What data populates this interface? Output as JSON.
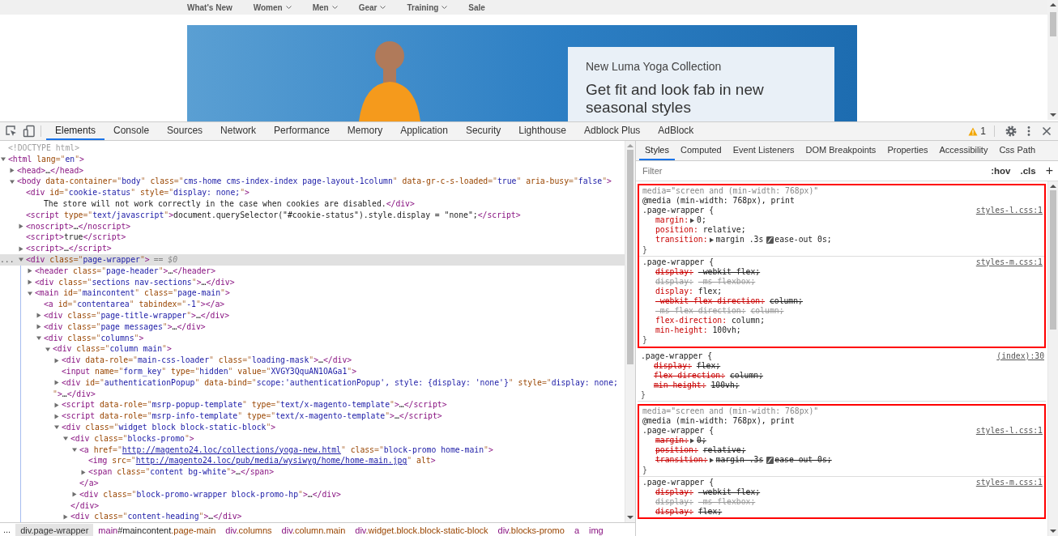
{
  "site": {
    "nav": [
      {
        "label": "What's New",
        "dropdown": false
      },
      {
        "label": "Women",
        "dropdown": true
      },
      {
        "label": "Men",
        "dropdown": true
      },
      {
        "label": "Gear",
        "dropdown": true
      },
      {
        "label": "Training",
        "dropdown": true
      },
      {
        "label": "Sale",
        "dropdown": false
      }
    ],
    "promo": {
      "eyebrow": "New Luma Yoga Collection",
      "headline": "Get fit and look fab in new seasonal styles"
    }
  },
  "devtools": {
    "tabs": [
      {
        "label": "Elements",
        "selected": true
      },
      {
        "label": "Console",
        "selected": false
      },
      {
        "label": "Sources",
        "selected": false
      },
      {
        "label": "Network",
        "selected": false
      },
      {
        "label": "Performance",
        "selected": false
      },
      {
        "label": "Memory",
        "selected": false
      },
      {
        "label": "Application",
        "selected": false
      },
      {
        "label": "Security",
        "selected": false
      },
      {
        "label": "Lighthouse",
        "selected": false
      },
      {
        "label": "Adblock Plus",
        "selected": false
      },
      {
        "label": "AdBlock",
        "selected": false
      }
    ],
    "warnings": "1",
    "dom_tree": [
      {
        "kind": "doctype",
        "text": "<!DOCTYPE html>",
        "selected": false
      },
      {
        "kind": "element",
        "text": "<html lang=\"en\">",
        "expanded": true,
        "selected": false,
        "children": [
          {
            "kind": "element",
            "text": "<head>…</head>",
            "expanded": false,
            "selected": false
          },
          {
            "kind": "element",
            "text": "<body data-container=\"body\" class=\"cms-home cms-index-index page-layout-1column\" data-gr-c-s-loaded=\"true\" aria-busy=\"false\">",
            "expanded": true,
            "selected": false,
            "children": [
              {
                "kind": "element",
                "text": "<div id=\"cookie-status\" style=\"display: none;\">",
                "selected": false,
                "children": [
                  {
                    "kind": "text",
                    "text": "The store will not work correctly in the case when cookies are disabled.</div>",
                    "selected": false
                  }
                ]
              },
              {
                "kind": "element",
                "text": "<script type=\"text/javascript\">document.querySelector(\"#cookie-status\").style.display = \"none\";</script>",
                "selected": false
              },
              {
                "kind": "element",
                "text": "<noscript>…</noscript>",
                "expanded": false,
                "selected": false
              },
              {
                "kind": "element",
                "text": "<script>true</script>",
                "selected": false
              },
              {
                "kind": "element",
                "text": "<script>…</script>",
                "expanded": false,
                "selected": false
              },
              {
                "kind": "element",
                "text": "<div class=\"page-wrapper\">",
                "expanded": true,
                "selected": true,
                "gutter": "...",
                "note": "== $0",
                "children": [
                  {
                    "kind": "element",
                    "text": "<header class=\"page-header\">…</header>",
                    "expanded": false,
                    "selected": false
                  },
                  {
                    "kind": "element",
                    "text": "<div class=\"sections nav-sections\">…</div>",
                    "expanded": false,
                    "selected": false
                  },
                  {
                    "kind": "element",
                    "text": "<main id=\"maincontent\" class=\"page-main\">",
                    "expanded": true,
                    "selected": false,
                    "children": [
                      {
                        "kind": "element",
                        "text": "<a id=\"contentarea\" tabindex=\"-1\"></a>",
                        "selected": false
                      },
                      {
                        "kind": "element",
                        "text": "<div class=\"page-title-wrapper\">…</div>",
                        "expanded": false,
                        "selected": false
                      },
                      {
                        "kind": "element",
                        "text": "<div class=\"page messages\">…</div>",
                        "expanded": false,
                        "selected": false
                      },
                      {
                        "kind": "element",
                        "text": "<div class=\"columns\">",
                        "expanded": true,
                        "selected": false,
                        "children": [
                          {
                            "kind": "element",
                            "text": "<div class=\"column main\">",
                            "expanded": true,
                            "selected": false,
                            "children": [
                              {
                                "kind": "element",
                                "text": "<div data-role=\"main-css-loader\" class=\"loading-mask\">…</div>",
                                "expanded": false,
                                "selected": false
                              },
                              {
                                "kind": "element",
                                "text": "<input name=\"form_key\" type=\"hidden\" value=\"XVGY3QquAN1OAGa1\">",
                                "selected": false
                              },
                              {
                                "kind": "element",
                                "text": "<div id=\"authenticationPopup\" data-bind=\"scope:'authenticationPopup', style: {display: 'none'}\" style=\"display: none;",
                                "continuation": "\">…</div>",
                                "expanded": false,
                                "selected": false
                              },
                              {
                                "kind": "element",
                                "text": "<script data-role=\"msrp-popup-template\" type=\"text/x-magento-template\">…</script>",
                                "expanded": false,
                                "selected": false
                              },
                              {
                                "kind": "element",
                                "text": "<script data-role=\"msrp-info-template\" type=\"text/x-magento-template\">…</script>",
                                "expanded": false,
                                "selected": false
                              },
                              {
                                "kind": "element",
                                "text": "<div class=\"widget block block-static-block\">",
                                "expanded": true,
                                "selected": false,
                                "children": [
                                  {
                                    "kind": "element",
                                    "text": "<div class=\"blocks-promo\">",
                                    "expanded": true,
                                    "selected": false,
                                    "closing": "</div>",
                                    "children": [
                                      {
                                        "kind": "element",
                                        "text": "<a href=\"http://magento24.loc/collections/yoga-new.html\" class=\"block-promo home-main\">",
                                        "expanded": true,
                                        "selected": false,
                                        "link": true,
                                        "closing": "</a>",
                                        "children": [
                                          {
                                            "kind": "element",
                                            "text": "<img src=\"http://magento24.loc/pub/media/wysiwyg/home/home-main.jpg\" alt>",
                                            "selected": false,
                                            "link": true
                                          },
                                          {
                                            "kind": "element",
                                            "text": "<span class=\"content bg-white\">…</span>",
                                            "expanded": false,
                                            "selected": false
                                          }
                                        ]
                                      },
                                      {
                                        "kind": "element",
                                        "text": "<div class=\"block-promo-wrapper block-promo-hp\">…</div>",
                                        "expanded": false,
                                        "selected": false
                                      }
                                    ]
                                  },
                                  {
                                    "kind": "element",
                                    "text": "<div class=\"content-heading\">…</div>",
                                    "expanded": false,
                                    "selected": false
                                  }
                                ]
                              }
                            ]
                          }
                        ]
                      }
                    ]
                  }
                ]
              }
            ]
          }
        ]
      }
    ],
    "breadcrumbs_more": "...",
    "breadcrumbs": [
      {
        "label": "div.page-wrapper",
        "selected": true
      },
      {
        "label": "main#maincontent.page-main",
        "selected": false
      },
      {
        "label": "div.columns",
        "selected": false
      },
      {
        "label": "div.column.main",
        "selected": false
      },
      {
        "label": "div.widget.block.block-static-block",
        "selected": false
      },
      {
        "label": "div.blocks-promo",
        "selected": false
      },
      {
        "label": "a",
        "selected": false
      },
      {
        "label": "img",
        "selected": false
      }
    ],
    "sidebar_tabs": [
      {
        "label": "Styles",
        "selected": true
      },
      {
        "label": "Computed",
        "selected": false
      },
      {
        "label": "Event Listeners",
        "selected": false
      },
      {
        "label": "DOM Breakpoints",
        "selected": false
      },
      {
        "label": "Properties",
        "selected": false
      },
      {
        "label": "Accessibility",
        "selected": false
      },
      {
        "label": "Css Path",
        "selected": false
      }
    ],
    "filter": {
      "placeholder": "Filter"
    },
    "hov": ":hov",
    "cls": ".cls",
    "add": "+",
    "rule_groups": [
      {
        "outlined": true,
        "rules": [
          {
            "media_source": "media=\"screen and (min-width: 768px)\"",
            "media": "@media (min-width: 768px), print",
            "selector": ".page-wrapper {",
            "source": "styles-l.css:1",
            "close": "}",
            "declarations": [
              {
                "name": "margin:",
                "value": "0;",
                "overridden": false,
                "invalid": false,
                "expandable": true
              },
              {
                "name": "position:",
                "value": "relative;",
                "overridden": false,
                "invalid": false,
                "expandable": false
              },
              {
                "name": "transition:",
                "value": "margin .3s",
                "easing": "ease-out 0s;",
                "overridden": false,
                "invalid": false,
                "expandable": true
              }
            ]
          },
          {
            "selector": ".page-wrapper {",
            "source": "styles-m.css:1",
            "close": "}",
            "declarations": [
              {
                "name": "display:",
                "value": "-webkit-flex;",
                "overridden": true,
                "invalid": false,
                "expandable": false
              },
              {
                "name": "display:",
                "value": "-ms-flexbox;",
                "overridden": true,
                "invalid": true,
                "expandable": false
              },
              {
                "name": "display:",
                "value": "flex;",
                "overridden": false,
                "invalid": false,
                "expandable": false
              },
              {
                "name": "-webkit-flex-direction:",
                "value": "column;",
                "overridden": true,
                "invalid": false,
                "expandable": false
              },
              {
                "name": "-ms-flex-direction:",
                "value": "column;",
                "overridden": true,
                "invalid": true,
                "expandable": false
              },
              {
                "name": "flex-direction:",
                "value": "column;",
                "overridden": false,
                "invalid": false,
                "expandable": false
              },
              {
                "name": "min-height:",
                "value": "100vh;",
                "overridden": false,
                "invalid": false,
                "expandable": false
              }
            ]
          }
        ]
      },
      {
        "outlined": false,
        "rules": [
          {
            "selector": ".page-wrapper {",
            "source": "(index):30",
            "close": "}",
            "declarations": [
              {
                "name": "display:",
                "value": "flex;",
                "overridden": true,
                "invalid": false,
                "expandable": false
              },
              {
                "name": "flex-direction:",
                "value": "column;",
                "overridden": true,
                "invalid": false,
                "expandable": false
              },
              {
                "name": "min-height:",
                "value": "100vh;",
                "overridden": true,
                "invalid": false,
                "expandable": false
              }
            ]
          }
        ]
      },
      {
        "outlined": true,
        "rules": [
          {
            "media_source": "media=\"screen and (min-width: 768px)\"",
            "media": "@media (min-width: 768px), print",
            "selector": ".page-wrapper {",
            "source": "styles-l.css:1",
            "close": "}",
            "declarations": [
              {
                "name": "margin:",
                "value": "0;",
                "overridden": true,
                "invalid": false,
                "expandable": true
              },
              {
                "name": "position:",
                "value": "relative;",
                "overridden": true,
                "invalid": false,
                "expandable": false
              },
              {
                "name": "transition:",
                "value": "margin .3s",
                "easing": "ease-out 0s;",
                "overridden": true,
                "invalid": false,
                "expandable": true
              }
            ]
          },
          {
            "selector": ".page-wrapper {",
            "source": "styles-m.css:1",
            "declarations": [
              {
                "name": "display:",
                "value": "-webkit-flex;",
                "overridden": true,
                "invalid": false,
                "expandable": false
              },
              {
                "name": "display:",
                "value": "-ms-flexbox;",
                "overridden": true,
                "invalid": true,
                "expandable": false
              },
              {
                "name": "display:",
                "value": "flex;",
                "overridden": true,
                "invalid": false,
                "expandable": false
              }
            ]
          }
        ]
      }
    ]
  }
}
